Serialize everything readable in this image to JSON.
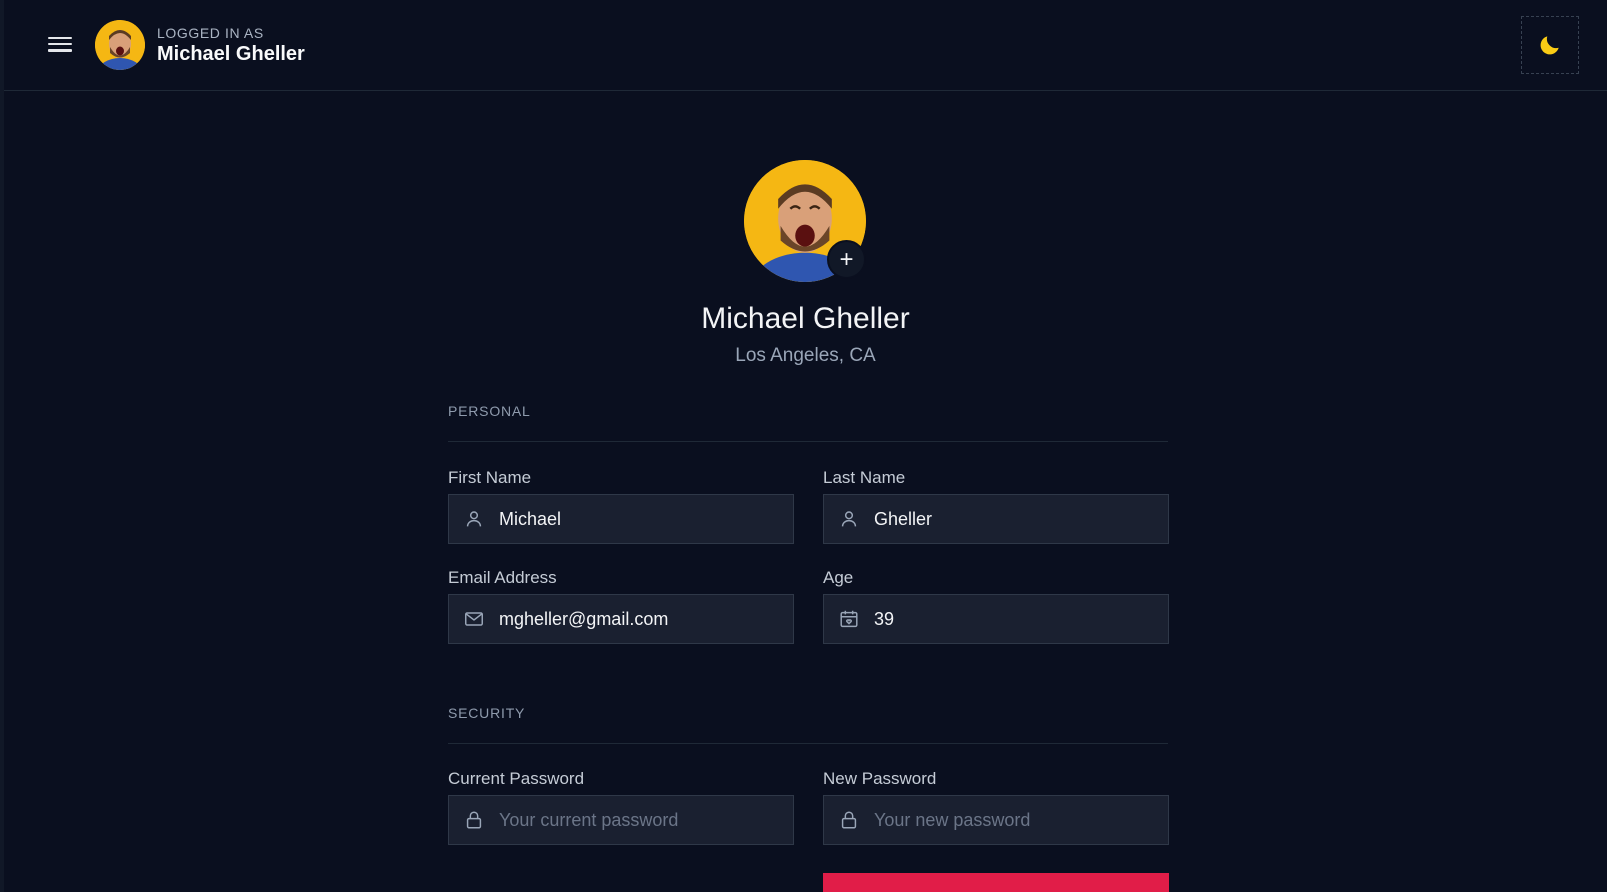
{
  "header": {
    "logged_in_label": "LOGGED IN AS",
    "user_name": "Michael Gheller",
    "menu_icon": "hamburger-menu-icon",
    "theme_icon": "moon-icon",
    "theme_icon_color": "#facc15"
  },
  "profile": {
    "name": "Michael Gheller",
    "location": "Los Angeles, CA",
    "add_photo_symbol": "+"
  },
  "sections": {
    "personal": "PERSONAL",
    "security": "SECURITY"
  },
  "fields": {
    "first_name": {
      "label": "First Name",
      "value": "Michael",
      "icon": "user-icon"
    },
    "last_name": {
      "label": "Last Name",
      "value": "Gheller",
      "icon": "user-icon"
    },
    "email": {
      "label": "Email Address",
      "value": "mgheller@gmail.com",
      "icon": "mail-icon"
    },
    "age": {
      "label": "Age",
      "value": "39",
      "icon": "calendar-icon"
    },
    "current_password": {
      "label": "Current Password",
      "placeholder": "Your current password",
      "icon": "lock-icon"
    },
    "new_password": {
      "label": "New Password",
      "placeholder": "Your new password",
      "icon": "lock-icon"
    }
  },
  "colors": {
    "background": "#0a0f1f",
    "input_bg": "#1a2030",
    "accent_button": "#e11d48",
    "avatar_bg": "#f5b713"
  }
}
